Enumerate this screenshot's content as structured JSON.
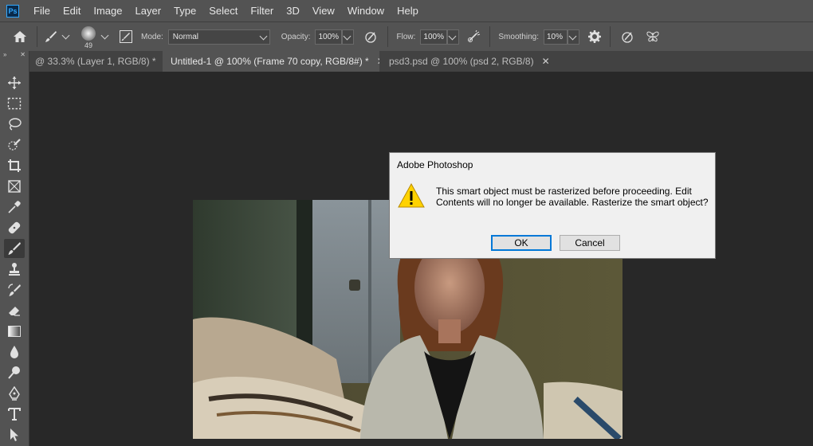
{
  "app": {
    "logo_text": "Ps"
  },
  "menu": [
    "File",
    "Edit",
    "Image",
    "Layer",
    "Type",
    "Select",
    "Filter",
    "3D",
    "View",
    "Window",
    "Help"
  ],
  "options": {
    "brush_size": "49",
    "mode_label": "Mode:",
    "mode_value": "Normal",
    "opacity_label": "Opacity:",
    "opacity_value": "100%",
    "flow_label": "Flow:",
    "flow_value": "100%",
    "smoothing_label": "Smoothing:",
    "smoothing_value": "10%"
  },
  "tabs": [
    {
      "label": "@ 33.3% (Layer 1, RGB/8) *",
      "close": "✕"
    },
    {
      "label": "Untitled-1 @ 100% (Frame 70 copy, RGB/8#) *",
      "close": "✕"
    },
    {
      "label": "psd3.psd @ 100% (psd 2, RGB/8)",
      "close": "✕"
    }
  ],
  "toolbar": {
    "collapse": "»",
    "close": "✕"
  },
  "dialog": {
    "title": "Adobe Photoshop",
    "message": "This smart object must be rasterized before proceeding.  Edit Contents will no longer be available.  Rasterize the smart object?",
    "ok_label": "OK",
    "cancel_label": "Cancel"
  },
  "colors": {
    "accent": "#0078d7",
    "panel": "#535353",
    "canvas_bg": "#282828"
  }
}
